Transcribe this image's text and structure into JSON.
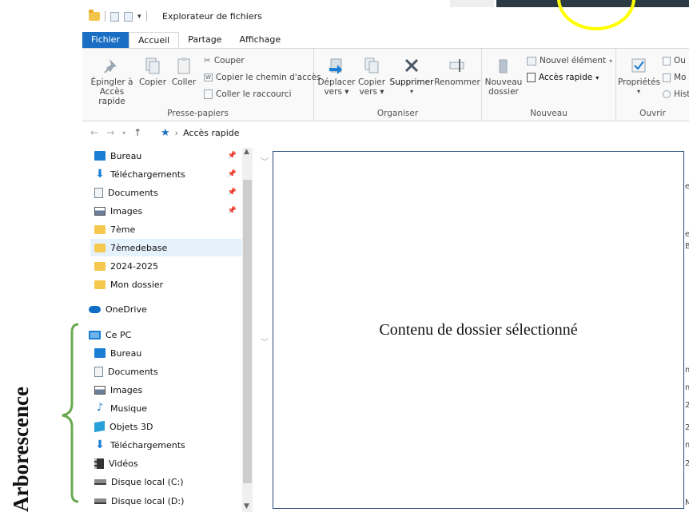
{
  "annotation": {
    "label": "Arborescence",
    "bracket_color": "#6aa84f"
  },
  "window": {
    "title": "Explorateur de fichiers",
    "accent_color": "#1a6fc4",
    "highlight_circle_color": "#ffff00"
  },
  "tabs": [
    {
      "label": "Fichier"
    },
    {
      "label": "Accueil"
    },
    {
      "label": "Partage"
    },
    {
      "label": "Affichage"
    }
  ],
  "ribbon": {
    "presse_papiers": {
      "label": "Presse-papiers",
      "pin_line1": "Épingler à",
      "pin_line2": "Accès rapide",
      "copy": "Copier",
      "paste": "Coller",
      "cut": "Couper",
      "copy_path": "Copier le chemin d'accès",
      "paste_shortcut": "Coller le raccourci"
    },
    "organiser": {
      "label": "Organiser",
      "move_line1": "Déplacer",
      "move_line2": "vers",
      "copyto_line1": "Copier",
      "copyto_line2": "vers",
      "delete": "Supprimer",
      "rename": "Renommer"
    },
    "nouveau": {
      "label": "Nouveau",
      "new_folder_line1": "Nouveau",
      "new_folder_line2": "dossier",
      "new_item": "Nouvel élément",
      "quick_access": "Accès rapide"
    },
    "ouvrir": {
      "label": "Ouvrir",
      "properties": "Propriétés",
      "open_frag": "Ou",
      "modify_frag": "Mo",
      "history_frag": "Hist"
    }
  },
  "address": {
    "path": "Accès rapide"
  },
  "nav_pane": {
    "quick_access": [
      {
        "label": "Bureau",
        "icon": "desktop-icon",
        "pinned": true
      },
      {
        "label": "Téléchargements",
        "icon": "download-icon",
        "pinned": true
      },
      {
        "label": "Documents",
        "icon": "document-icon",
        "pinned": true
      },
      {
        "label": "Images",
        "icon": "image-icon",
        "pinned": true
      },
      {
        "label": "7ème",
        "icon": "folder-icon",
        "pinned": false
      },
      {
        "label": "7èmedebase",
        "icon": "folder-icon",
        "pinned": false
      },
      {
        "label": "2024-2025",
        "icon": "folder-icon",
        "pinned": false
      },
      {
        "label": "Mon dossier",
        "icon": "folder-icon",
        "pinned": false
      }
    ],
    "onedrive": "OneDrive",
    "this_pc": "Ce PC",
    "pc_items": [
      {
        "label": "Bureau",
        "icon": "desktop-icon"
      },
      {
        "label": "Documents",
        "icon": "document-icon"
      },
      {
        "label": "Images",
        "icon": "image-icon"
      },
      {
        "label": "Musique",
        "icon": "music-icon"
      },
      {
        "label": "Objets 3D",
        "icon": "3d-objects-icon"
      },
      {
        "label": "Téléchargements",
        "icon": "download-icon"
      },
      {
        "label": "Vidéos",
        "icon": "video-icon"
      },
      {
        "label": "Disque local (C:)",
        "icon": "disk-icon"
      },
      {
        "label": "Disque local (D:)",
        "icon": "disk-icon"
      }
    ]
  },
  "content": {
    "label": "Contenu de dossier sélectionné",
    "clipped_chars": [
      "e",
      "el",
      "Bo",
      "m",
      "m",
      "20",
      "20",
      "m",
      "20",
      "M"
    ]
  }
}
